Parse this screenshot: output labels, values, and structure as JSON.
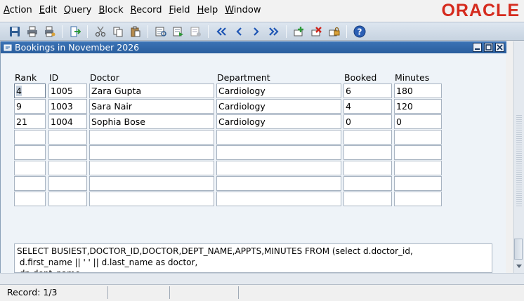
{
  "menu": [
    {
      "acc": "A",
      "rest": "ction"
    },
    {
      "acc": "E",
      "rest": "dit"
    },
    {
      "acc": "Q",
      "rest": "uery"
    },
    {
      "acc": "B",
      "rest": "lock"
    },
    {
      "acc": "R",
      "rest": "ecord"
    },
    {
      "acc": "F",
      "rest": "ield"
    },
    {
      "acc": "H",
      "rest": "elp"
    },
    {
      "acc": "W",
      "rest": "indow"
    }
  ],
  "brand": {
    "logo": "ORACLE",
    "color": "#d52b1e"
  },
  "toolbar_icons": [
    "save-icon",
    "print-icon",
    "print-setup-icon",
    "exit-icon",
    "cut-icon",
    "copy-icon",
    "paste-icon",
    "enter-query-icon",
    "execute-query-icon",
    "cancel-query-icon",
    "first-record-icon",
    "previous-record-icon",
    "next-record-icon",
    "last-record-icon",
    "insert-record-icon",
    "delete-record-icon",
    "lock-record-icon",
    "help-icon"
  ],
  "window": {
    "title": "Bookings in November 2026",
    "title_color": "#2f67aa"
  },
  "columns": [
    "Rank",
    "ID",
    "Doctor",
    "Department",
    "Booked",
    "Minutes"
  ],
  "rows": [
    [
      "4",
      "1005",
      "Zara Gupta",
      "Cardiology",
      "6",
      "180"
    ],
    [
      "9",
      "1003",
      "Sara Nair",
      "Cardiology",
      "4",
      "120"
    ],
    [
      "21",
      "1004",
      "Sophia Bose",
      "Cardiology",
      "0",
      "0"
    ],
    [
      "",
      "",
      "",
      "",
      "",
      ""
    ],
    [
      "",
      "",
      "",
      "",
      "",
      ""
    ],
    [
      "",
      "",
      "",
      "",
      "",
      ""
    ],
    [
      "",
      "",
      "",
      "",
      "",
      ""
    ],
    [
      "",
      "",
      "",
      "",
      "",
      ""
    ]
  ],
  "sql_text": "SELECT BUSIEST,DOCTOR_ID,DOCTOR,DEPT_NAME,APPTS,MINUTES FROM (select d.doctor_id,\n d.first_name || ' ' || d.last_name as doctor,\n dp.dept_name,",
  "status": {
    "record": "Record: 1/3"
  }
}
